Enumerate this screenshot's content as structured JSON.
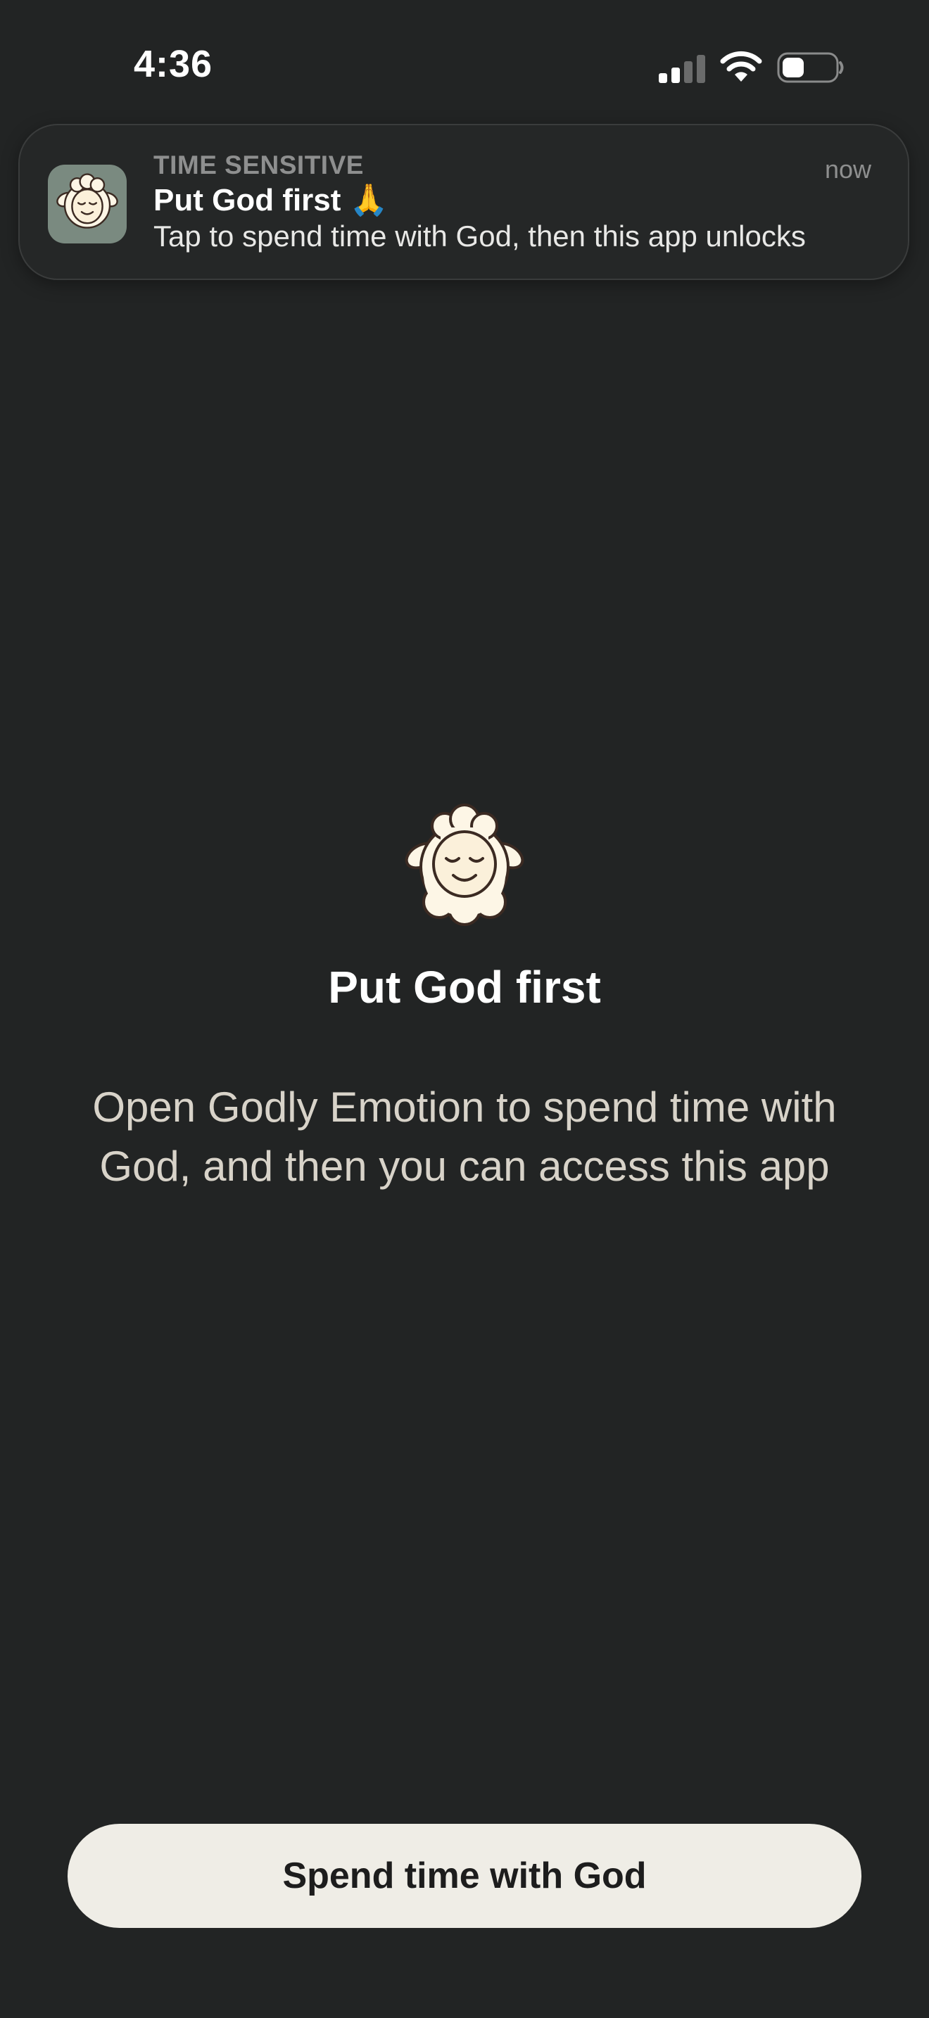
{
  "status_bar": {
    "time": "4:36",
    "icons": [
      "cellular-signal-icon",
      "wifi-icon",
      "battery-icon"
    ]
  },
  "notification": {
    "category": "TIME SENSITIVE",
    "time": "now",
    "title": "Put God first 🙏",
    "body": "Tap to spend time with God, then this app unlocks",
    "app_icon": "sheep-icon"
  },
  "main": {
    "icon": "sheep-icon",
    "heading": "Put God first",
    "subtitle": "Open Godly Emotion to spend time with God, and then you can access this app"
  },
  "action": {
    "button_label": "Spend time with God"
  },
  "colors": {
    "background": "#222424",
    "notification_bg": "#252727",
    "button_bg": "#efede6",
    "subtitle_text": "#d8d3c9",
    "app_icon_bg": "#7a8a80",
    "sheep_wool": "#fdf6e6",
    "sheep_outline": "#3b2a22"
  }
}
